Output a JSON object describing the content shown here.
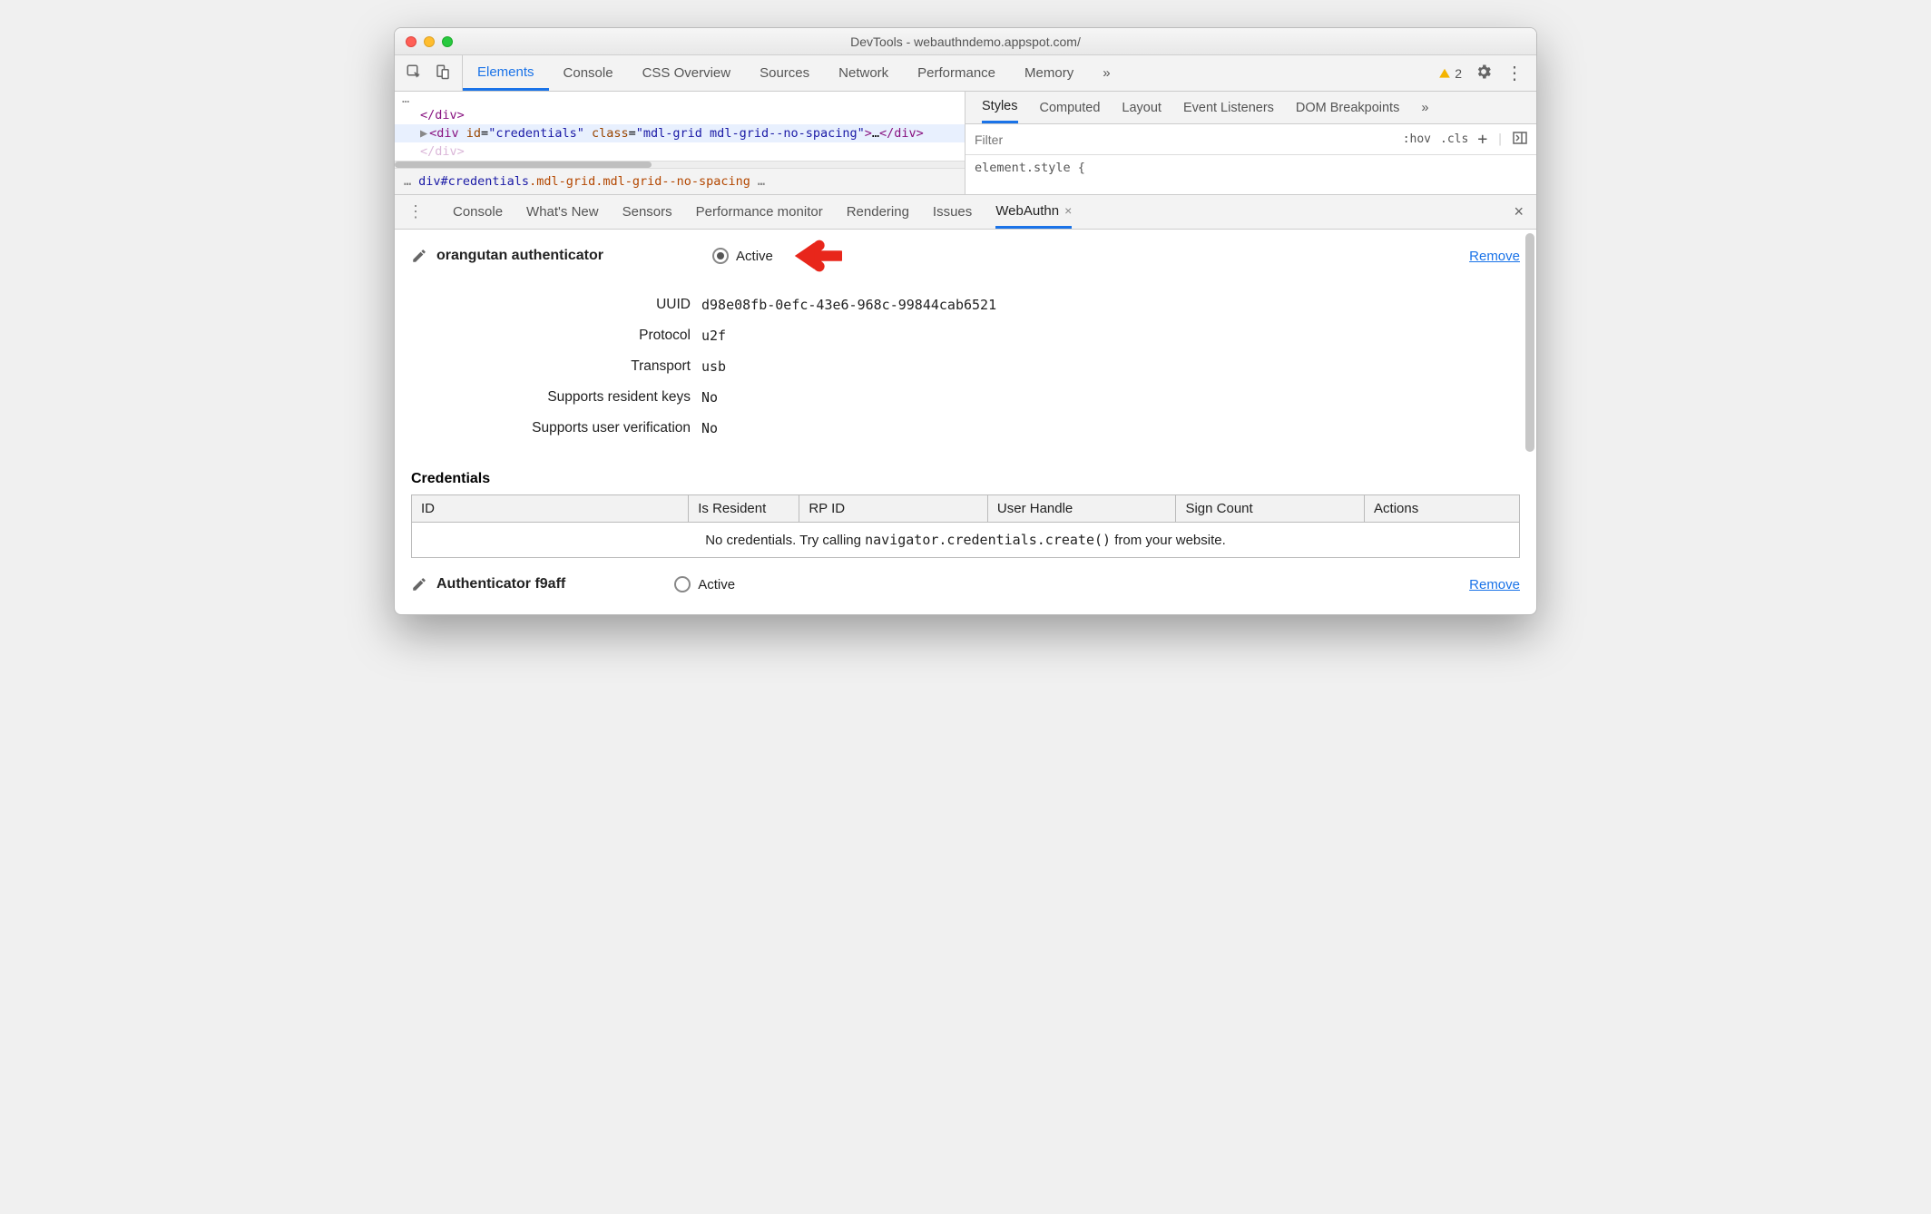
{
  "window": {
    "title": "DevTools - webauthndemo.appspot.com/"
  },
  "main_tabs": {
    "elements": "Elements",
    "console": "Console",
    "css_overview": "CSS Overview",
    "sources": "Sources",
    "network": "Network",
    "performance": "Performance",
    "memory": "Memory",
    "more": "»"
  },
  "warnings": {
    "count": "2"
  },
  "dom": {
    "line0": "</div>",
    "hl_prefix": "▶",
    "hl_open": "<div id=\"credentials\" class=\"mdl-grid mdl-grid--no-spacing\">",
    "hl_ell": "…",
    "hl_close": "</div>",
    "line_after": "</div>",
    "more_top": "…",
    "breadcrumb_left_dots": "…",
    "breadcrumb_part1": "div#credentials",
    "breadcrumb_part2": ".mdl-grid.mdl-grid--no-spacing",
    "breadcrumb_right_dots": "…"
  },
  "styles_tabs": {
    "styles": "Styles",
    "computed": "Computed",
    "layout": "Layout",
    "event_listeners": "Event Listeners",
    "dom_breakpoints": "DOM Breakpoints",
    "more": "»"
  },
  "filter": {
    "placeholder": "Filter",
    "hov": ":hov",
    "cls": ".cls",
    "plus": "+"
  },
  "element_style": "element.style {",
  "drawer_tabs": {
    "console": "Console",
    "whats_new": "What's New",
    "sensors": "Sensors",
    "perf_monitor": "Performance monitor",
    "rendering": "Rendering",
    "issues": "Issues",
    "webauthn": "WebAuthn"
  },
  "auth1": {
    "name": "orangutan authenticator",
    "active_label": "Active",
    "remove": "Remove",
    "rows": {
      "uuid_l": "UUID",
      "uuid_v": "d98e08fb-0efc-43e6-968c-99844cab6521",
      "protocol_l": "Protocol",
      "protocol_v": "u2f",
      "transport_l": "Transport",
      "transport_v": "usb",
      "resident_l": "Supports resident keys",
      "resident_v": "No",
      "uv_l": "Supports user verification",
      "uv_v": "No"
    }
  },
  "credentials": {
    "heading": "Credentials",
    "cols": {
      "id": "ID",
      "is_resident": "Is Resident",
      "rp_id": "RP ID",
      "user_handle": "User Handle",
      "sign_count": "Sign Count",
      "actions": "Actions"
    },
    "empty_pre": "No credentials. Try calling ",
    "empty_code": "navigator.credentials.create()",
    "empty_post": " from your website."
  },
  "auth2": {
    "name": "Authenticator f9aff",
    "active_label": "Active",
    "remove": "Remove"
  }
}
